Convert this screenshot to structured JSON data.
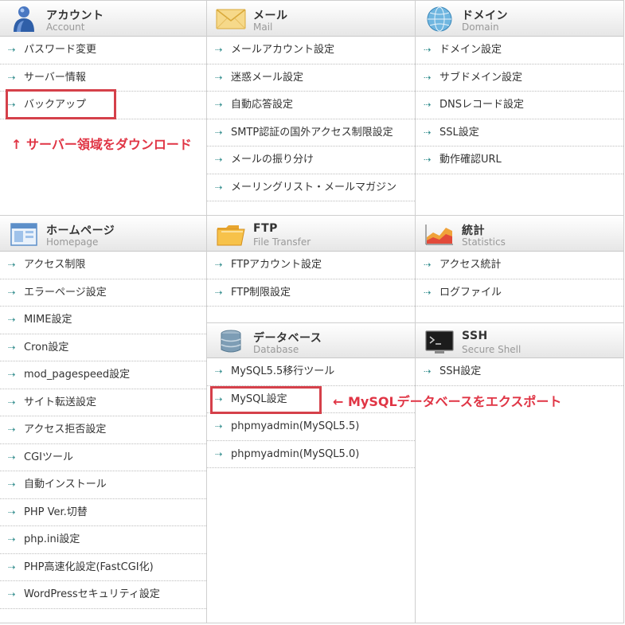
{
  "sections": {
    "account": {
      "title": "アカウント",
      "subtitle": "Account",
      "icon": "account-user-icon",
      "items": [
        "パスワード変更",
        "サーバー情報",
        "バックアップ"
      ]
    },
    "mail": {
      "title": "メール",
      "subtitle": "Mail",
      "icon": "envelope-icon",
      "items": [
        "メールアカウント設定",
        "迷惑メール設定",
        "自動応答設定",
        "SMTP認証の国外アクセス制限設定",
        "メールの振り分け",
        "メーリングリスト・メールマガジン"
      ]
    },
    "domain": {
      "title": "ドメイン",
      "subtitle": "Domain",
      "icon": "globe-icon",
      "items": [
        "ドメイン設定",
        "サブドメイン設定",
        "DNSレコード設定",
        "SSL設定",
        "動作確認URL"
      ]
    },
    "homepage": {
      "title": "ホームページ",
      "subtitle": "Homepage",
      "icon": "browser-window-icon",
      "items": [
        "アクセス制限",
        "エラーページ設定",
        "MIME設定",
        "Cron設定",
        "mod_pagespeed設定",
        "サイト転送設定",
        "アクセス拒否設定",
        "CGIツール",
        "自動インストール",
        "PHP Ver.切替",
        "php.ini設定",
        "PHP高速化設定(FastCGI化)",
        "WordPressセキュリティ設定"
      ]
    },
    "ftp": {
      "title": "FTP",
      "subtitle": "File Transfer",
      "icon": "folder-icon",
      "items": [
        "FTPアカウント設定",
        "FTP制限設定"
      ]
    },
    "statistics": {
      "title": "統計",
      "subtitle": "Statistics",
      "icon": "chart-icon",
      "items": [
        "アクセス統計",
        "ログファイル"
      ]
    },
    "database": {
      "title": "データベース",
      "subtitle": "Database",
      "icon": "database-icon",
      "items": [
        "MySQL5.5移行ツール",
        "MySQL設定",
        "phpmyadmin(MySQL5.5)",
        "phpmyadmin(MySQL5.0)"
      ]
    },
    "ssh": {
      "title": "SSH",
      "subtitle": "Secure Shell",
      "icon": "terminal-icon",
      "items": [
        "SSH設定"
      ]
    }
  },
  "annotations": {
    "backup_note": "↑ サーバー領域をダウンロード",
    "mysql_note": "← MySQLデータベースをエクスポート"
  },
  "colors": {
    "highlight": "#d5404a",
    "annotation_text": "#e03545",
    "item_arrow": "#2e8b8b"
  }
}
